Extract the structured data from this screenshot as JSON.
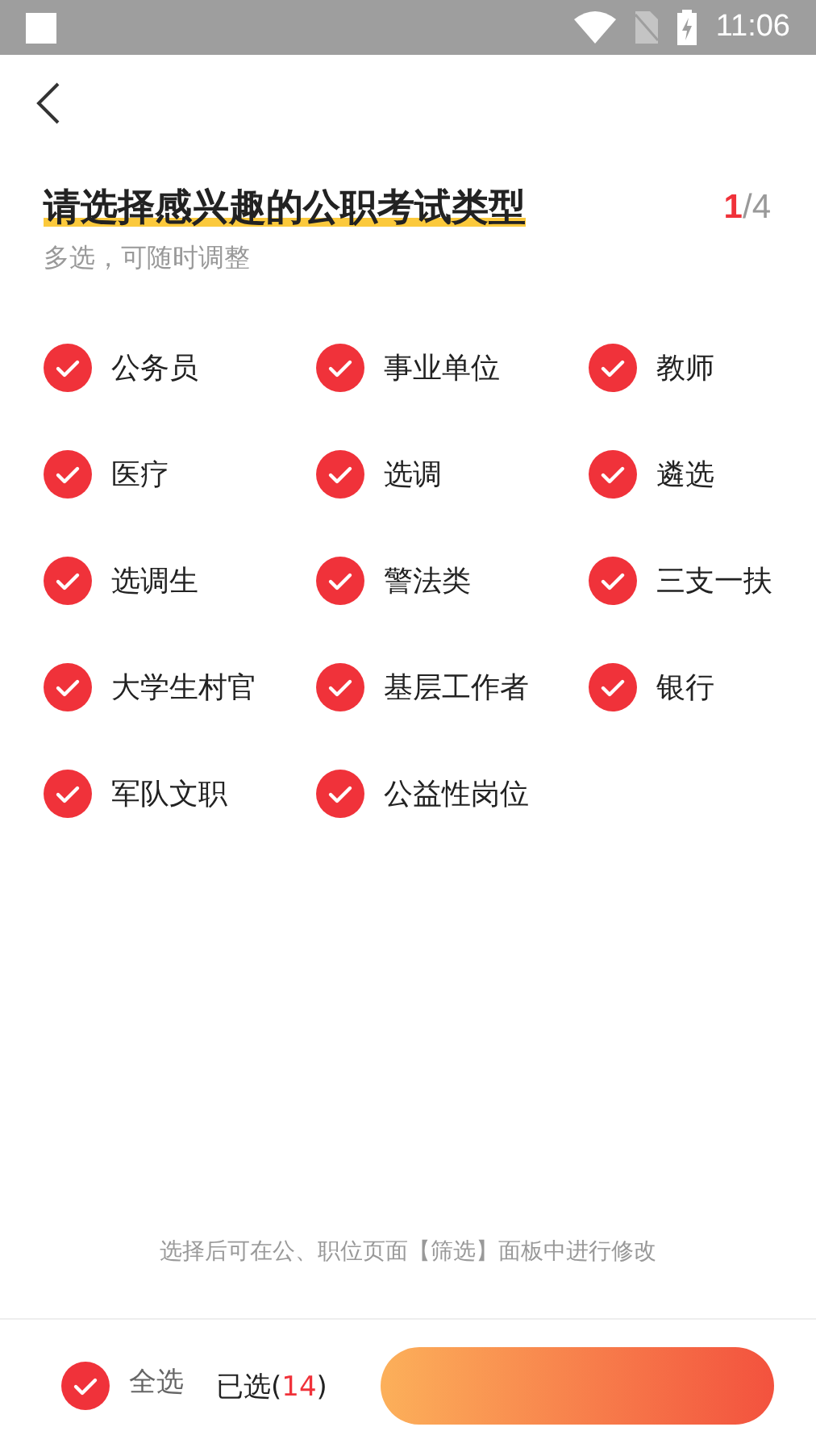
{
  "status_bar": {
    "time": "11:06"
  },
  "title": "请选择感兴趣的公职考试类型",
  "step": {
    "current": "1",
    "total": "/4"
  },
  "subtitle": "多选，可随时调整",
  "options": [
    {
      "label": "公务员",
      "checked": true
    },
    {
      "label": "事业单位",
      "checked": true
    },
    {
      "label": "教师",
      "checked": true
    },
    {
      "label": "医疗",
      "checked": true
    },
    {
      "label": "选调",
      "checked": true
    },
    {
      "label": "遴选",
      "checked": true
    },
    {
      "label": "选调生",
      "checked": true
    },
    {
      "label": "警法类",
      "checked": true
    },
    {
      "label": "三支一扶",
      "checked": true
    },
    {
      "label": "大学生村官",
      "checked": true
    },
    {
      "label": "基层工作者",
      "checked": true
    },
    {
      "label": "银行",
      "checked": true
    },
    {
      "label": "军队文职",
      "checked": true
    },
    {
      "label": "公益性岗位",
      "checked": true
    }
  ],
  "note": "选择后可在公、职位页面【筛选】面板中进行修改",
  "bottom_bar": {
    "select_all": {
      "label": "全选",
      "checked": true
    },
    "selected": {
      "prefix": "已选(",
      "count": "14",
      "suffix": ")"
    }
  }
}
